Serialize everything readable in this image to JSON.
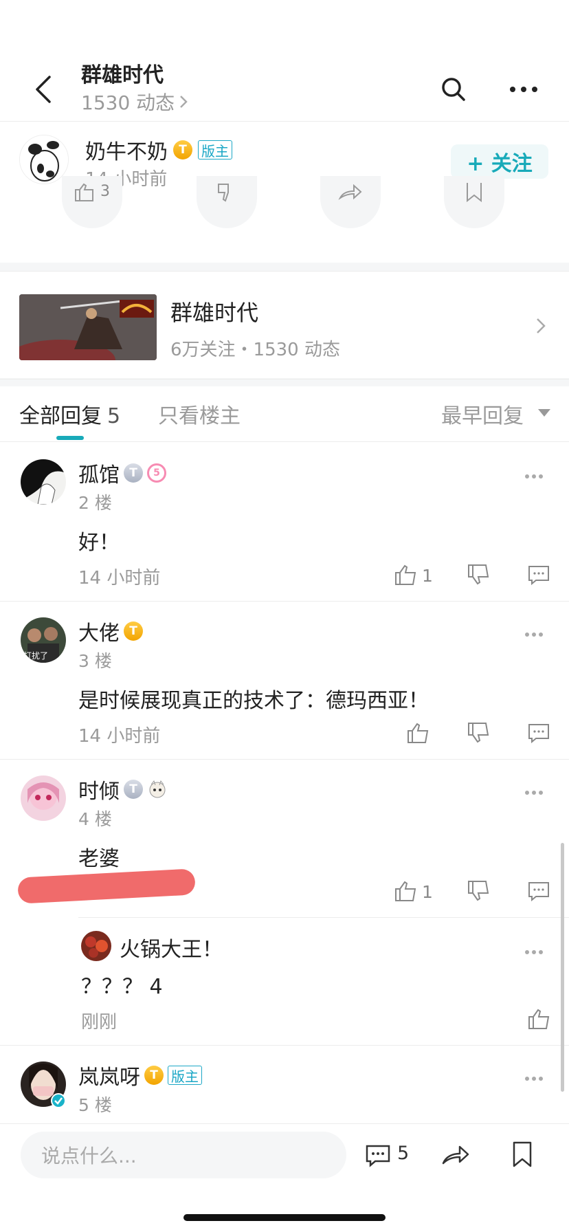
{
  "header": {
    "title": "群雄时代",
    "subtitle": "1530 动态"
  },
  "author": {
    "name": "奶牛不奶",
    "level_badge": "T",
    "role_badge": "版主",
    "time": "14 小时前",
    "follow_label": "+ 关注"
  },
  "post_actions": {
    "like_count": "3"
  },
  "topic": {
    "title": "群雄时代",
    "stats": "6万关注・1530 动态"
  },
  "tabs": {
    "all_label": "全部回复",
    "all_count": "5",
    "owner_label": "只看楼主",
    "sort_label": "最早回复"
  },
  "comments": [
    {
      "name": "孤馆",
      "level_badge": "T",
      "extra_badge": "5",
      "floor": "2 楼",
      "text": "好！",
      "time": "14 小时前",
      "like_count": "1"
    },
    {
      "name": "大佬",
      "level_badge": "T",
      "floor": "3 楼",
      "text": "是时候展现真正的技术了：德玛西亚！",
      "time": "14 小时前",
      "like_count": ""
    },
    {
      "name": "时倾",
      "level_badge": "T",
      "floor": "4 楼",
      "text": "老婆",
      "time": "",
      "like_count": "1",
      "reply": {
        "name": "火锅大王！",
        "text": "？？？ 4",
        "time": "刚刚"
      }
    },
    {
      "name": "岚岚呀",
      "level_badge": "T",
      "role_badge": "版主",
      "floor": "5 楼"
    }
  ],
  "bottom_bar": {
    "input_placeholder": "说点什么...",
    "comment_count": "5"
  },
  "colors": {
    "accent": "#18aab9",
    "badge_gold": "#f2a400",
    "strike_red": "#f06b6b"
  }
}
